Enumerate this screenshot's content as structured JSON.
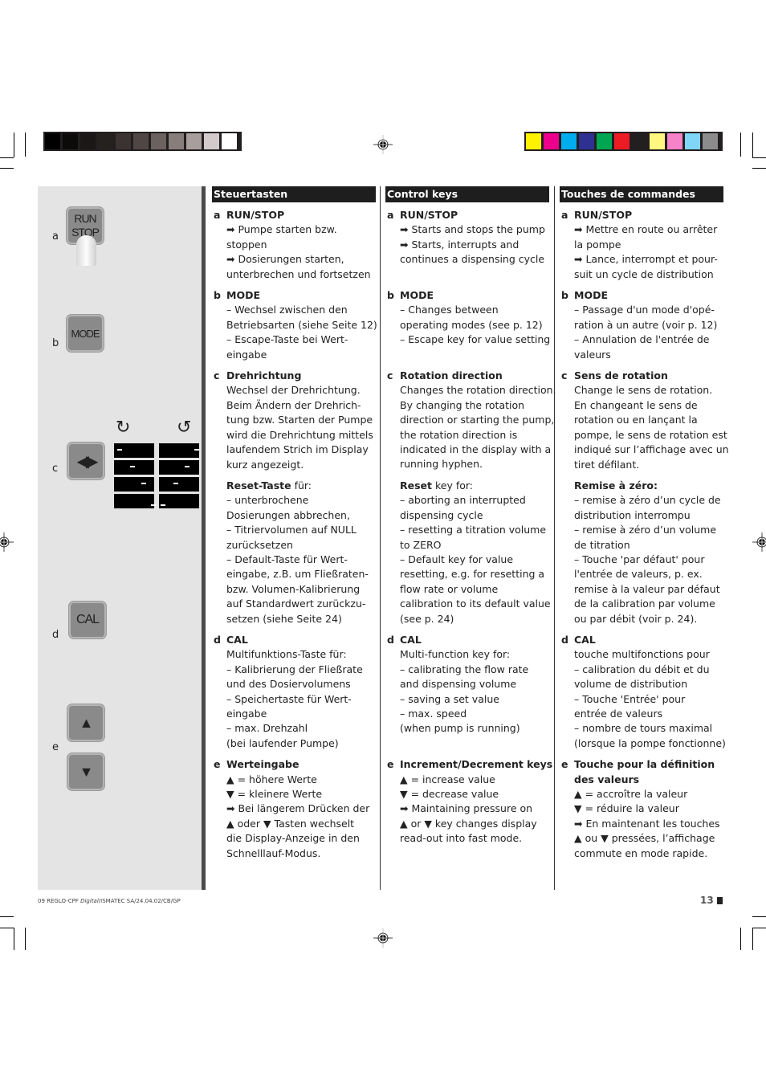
{
  "color_bars": {
    "grayscale": [
      "#000000",
      "#0d0b0a",
      "#1a1716",
      "#25211f",
      "#3b3331",
      "#504745",
      "#6b6260",
      "#877e7c",
      "#a89f9d",
      "#d3cbcb",
      "#ffffff"
    ],
    "process": [
      "#fff200",
      "#ec008c",
      "#00aeef",
      "#2e3192",
      "#00a651",
      "#ed1c24",
      "#231f20",
      "#fff77f",
      "#f682c8",
      "#7fd6f7",
      "#8c8c8c"
    ]
  },
  "illustrations": {
    "a": {
      "letter": "a",
      "key_line1": "RUN",
      "key_line2": "STOP"
    },
    "b": {
      "letter": "b",
      "key_label": "MODE"
    },
    "c": {
      "letter": "c",
      "key_symbol": "◀▶",
      "cw_icon": "↻",
      "ccw_icon": "↺"
    },
    "d": {
      "letter": "d",
      "key_label": "CAL"
    },
    "e": {
      "letter": "e",
      "up_symbol": "▲",
      "down_symbol": "▼"
    }
  },
  "columns": [
    {
      "header": "Steuertasten",
      "sections": [
        {
          "letter": "a",
          "title": "RUN/STOP",
          "lines": [
            "➡ Pumpe starten bzw.",
            "stoppen",
            "➡ Dosierungen starten,",
            "unterbrechen und fortsetzen"
          ]
        },
        {
          "letter": "b",
          "title": "MODE",
          "lines": [
            "–   Wechsel zwischen den",
            "Betriebsarten (siehe Seite 12)",
            "–   Escape-Taste bei Wert-",
            "eingabe"
          ]
        },
        {
          "letter": "c",
          "title": "Drehrichtung",
          "lines": [
            "Wechsel der Drehrichtung.",
            "Beim Ändern der Drehrich-",
            "tung  bzw. Starten der Pumpe",
            "wird die Drehrichtung mittels",
            "laufendem Strich im Display",
            "kurz angezeigt."
          ],
          "sub_title": "Reset-Taste",
          "sub_title_suffix": " für:",
          "sub_lines": [
            "–   unterbrochene",
            "Dosierungen abbrechen,",
            "–   Titriervolumen auf NULL",
            "zurücksetzen",
            "–   Default-Taste für Wert-",
            "eingabe, z.B. um Fließraten-",
            "bzw. Volumen-Kalibrierung",
            "auf Standardwert zurückzu-",
            "setzen (siehe Seite 24)"
          ]
        },
        {
          "letter": "d",
          "title": "CAL",
          "lines": [
            "Multifunktions-Taste für:",
            "–   Kalibrierung der Fließrate",
            "und des Dosiervolumens",
            "–   Speichertaste für Wert-",
            "eingabe",
            "–   max. Drehzahl",
            "(bei laufender Pumpe)"
          ]
        },
        {
          "letter": "e",
          "title": "Werteingabe",
          "lines": [
            "▲ = höhere Werte",
            "▼ = kleinere Werte",
            "➡ Bei längerem Drücken der",
            "▲ oder ▼  Tasten wechselt",
            "die Display-Anzeige in den",
            "Schnelllauf-Modus."
          ]
        }
      ]
    },
    {
      "header": "Control keys",
      "sections": [
        {
          "letter": "a",
          "title": "RUN/STOP",
          "lines": [
            "➡ Starts and stops the pump",
            "➡ Starts, interrupts and",
            "continues a dispensing cycle",
            ""
          ]
        },
        {
          "letter": "b",
          "title": "MODE",
          "lines": [
            "–   Changes between",
            "operating modes (see p. 12)",
            "  –  Escape key for value setting",
            ""
          ]
        },
        {
          "letter": "c",
          "title": "Rotation direction",
          "lines": [
            "Changes the rotation direction.",
            "By changing the rotation",
            "direction or starting the pump,",
            "the rotation direction is",
            "indicated in the display with a",
            "running hyphen."
          ],
          "sub_title": "Reset",
          "sub_title_suffix": " key for:",
          "sub_lines": [
            "–   aborting an interrupted",
            "dispensing cycle",
            "–   resetting a titration volume",
            "to ZERO",
            "–   Default key for value",
            "resetting, e.g. for resetting a",
            "flow rate or volume",
            "calibration to its default value",
            "(see p. 24)"
          ]
        },
        {
          "letter": "d",
          "title": "CAL",
          "lines": [
            "Multi-function key for:",
            "–   calibrating the flow rate",
            "and dispensing volume",
            "–   saving a set value",
            "–   max. speed",
            "(when pump is running)",
            ""
          ]
        },
        {
          "letter": "e",
          "title": "Increment/Decrement keys",
          "lines": [
            "▲ = increase value",
            "▼ = decrease value",
            "➡ Maintaining pressure on",
            "▲ or ▼ key changes display",
            "read-out into fast mode."
          ]
        }
      ]
    },
    {
      "header": "Touches de commandes",
      "sections": [
        {
          "letter": "a",
          "title": "RUN/STOP",
          "lines": [
            "➡ Mettre en route ou arrêter",
            "la pompe",
            "➡ Lance, interrompt et pour-",
            "suit un cycle de distribution"
          ]
        },
        {
          "letter": "b",
          "title": "MODE",
          "lines": [
            "–   Passage d'un mode d'opé-",
            "ration à un autre (voir p. 12)",
            "–   Annulation de l'entrée de",
            "valeurs"
          ]
        },
        {
          "letter": "c",
          "title": "Sens de rotation",
          "lines": [
            "Change le sens de rotation.",
            "En changeant le sens de",
            "rotation ou en lançant la",
            "pompe, le sens de rotation est",
            "indiqué sur l’affichage avec un",
            "tiret défilant."
          ],
          "sub_title": "Remise à zéro:",
          "sub_title_suffix": "",
          "sub_lines": [
            "–   remise à zéro d’un cycle de",
            "distribution interrompu",
            "–   remise à zéro d’un volume",
            "de titration",
            "–   Touche 'par défaut' pour",
            "l'entrée de valeurs, p. ex.",
            "remise à la valeur par défaut",
            "de la calibration par volume",
            "ou par débit (voir p. 24)."
          ]
        },
        {
          "letter": "d",
          "title": "CAL",
          "lines": [
            "touche multifonctions pour",
            "–   calibration du débit et du",
            "volume de distribution",
            "–   Touche 'Entrée' pour",
            "entrée de valeurs",
            "–   nombre de tours maximal",
            "(lorsque la pompe fonctionne)"
          ]
        },
        {
          "letter": "e",
          "title": "Touche pour la définition",
          "title2": "des valeurs",
          "lines": [
            "▲ = accroître la valeur",
            "▼ = réduire la valeur",
            "➡ En maintenant les touches",
            "▲ ou ▼ pressées, l’affichage",
            "commute en mode rapide."
          ]
        }
      ]
    }
  ],
  "footer": {
    "doc_ref_prefix": "09 REGLO-CPF ",
    "doc_ref_italic": "Digital",
    "doc_ref_suffix": "/ISMATEC SA/24.04.02/CB/GP",
    "page_number": "13"
  }
}
